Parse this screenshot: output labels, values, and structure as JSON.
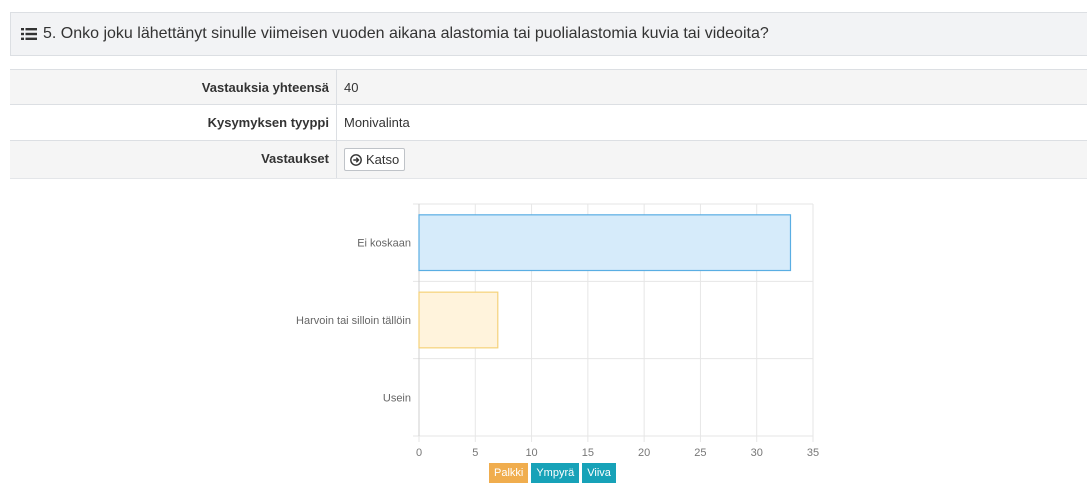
{
  "question": {
    "icon": "list-icon",
    "title": "5. Onko joku lähettänyt sinulle viimeisen vuoden aikana alastomia tai puolialastomia kuvia tai videoita?"
  },
  "info": {
    "total_label": "Vastauksia yhteensä",
    "total_value": "40",
    "type_label": "Kysymyksen tyyppi",
    "type_value": "Monivalinta",
    "answers_label": "Vastaukset",
    "view_button": "Katso",
    "view_icon": "circle-arrow-right-icon"
  },
  "chart_buttons": [
    {
      "label": "Palkki",
      "color": "#f0ad4e"
    },
    {
      "label": "Ympyrä",
      "color": "#17a2b8"
    },
    {
      "label": "Viiva",
      "color": "#17a2b8"
    }
  ],
  "chart_data": {
    "type": "bar",
    "orientation": "horizontal",
    "categories": [
      "Ei koskaan",
      "Harvoin tai silloin tällöin",
      "Usein"
    ],
    "values": [
      33,
      7,
      0
    ],
    "xlim": [
      0,
      35
    ],
    "xticks": [
      0,
      5,
      10,
      15,
      20,
      25,
      30,
      35
    ],
    "grid": true,
    "colors": [
      {
        "fill": "#d6ebfa",
        "stroke": "#5aaee3"
      },
      {
        "fill": "#fff3dc",
        "stroke": "#f5d27a"
      },
      {
        "fill": "#f5f5f5",
        "stroke": "#cccccc"
      }
    ]
  }
}
